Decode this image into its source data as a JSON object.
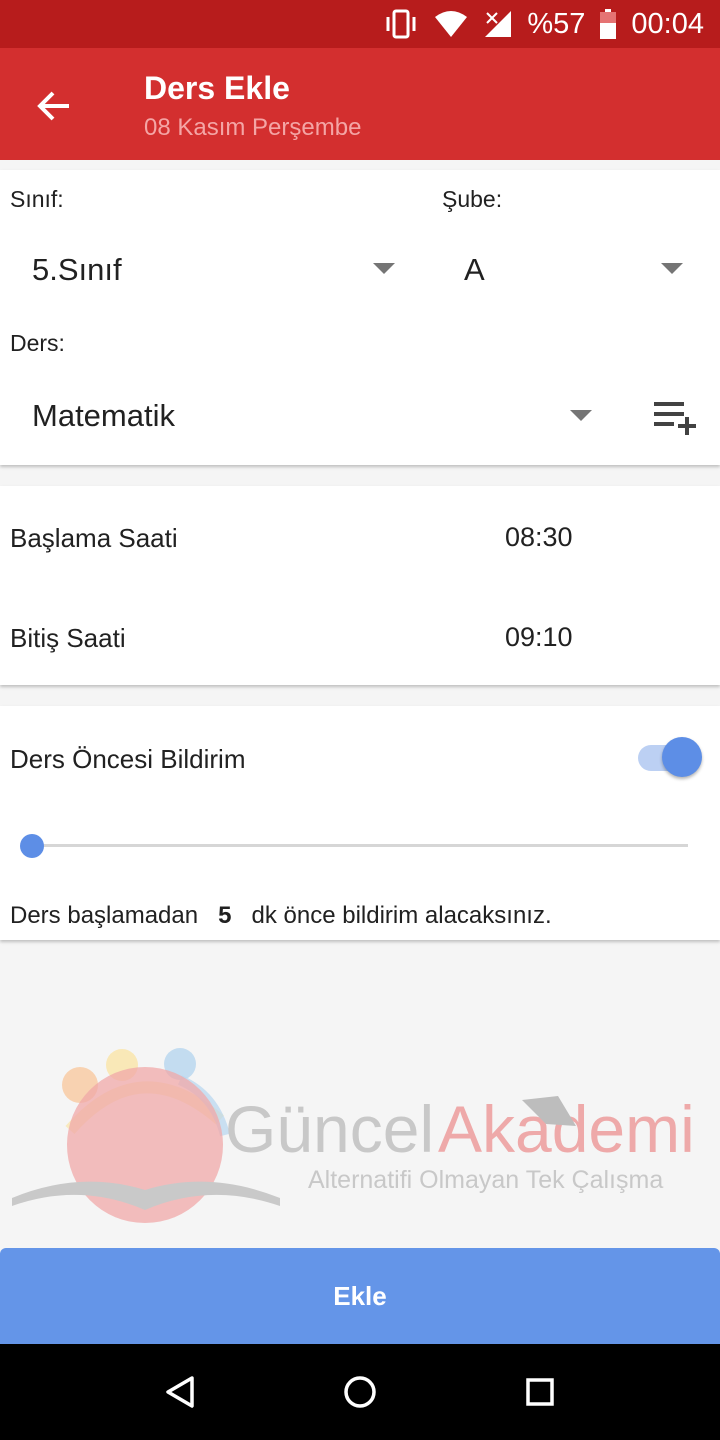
{
  "status_bar": {
    "battery": "%57",
    "time": "00:04",
    "icons": [
      "vibrate-icon",
      "wifi-icon",
      "signal-icon",
      "battery-icon"
    ]
  },
  "app_bar": {
    "title": "Ders Ekle",
    "subtitle": "08 Kasım Perşembe",
    "back_icon": "arrow-back-icon"
  },
  "class_card": {
    "class_label": "Sınıf:",
    "class_value": "5.Sınıf",
    "section_label": "Şube:",
    "section_value": "A",
    "lesson_label": "Ders:",
    "lesson_value": "Matematik",
    "add_lesson_icon": "playlist-add-icon"
  },
  "time_card": {
    "start_label": "Başlama Saati",
    "start_value": "08:30",
    "end_label": "Bitiş Saati",
    "end_value": "09:10"
  },
  "notification_card": {
    "label": "Ders Öncesi Bildirim",
    "enabled": true,
    "slider_fraction": 0.0,
    "note_prefix": "Ders başlamadan",
    "minutes": "5",
    "note_suffix": "dk önce bildirim alacaksınız."
  },
  "watermark": {
    "brand_1": "Güncel",
    "brand_2": "Akademi",
    "tagline": "Alternatifi Olmayan Tek Çalışma"
  },
  "submit": {
    "label": "Ekle"
  },
  "nav": [
    "back-triangle-icon",
    "home-circle-icon",
    "recents-square-icon"
  ],
  "colors": {
    "primary": "#d32f2f",
    "primary_dark": "#b71c1c",
    "accent": "#6495e8"
  }
}
